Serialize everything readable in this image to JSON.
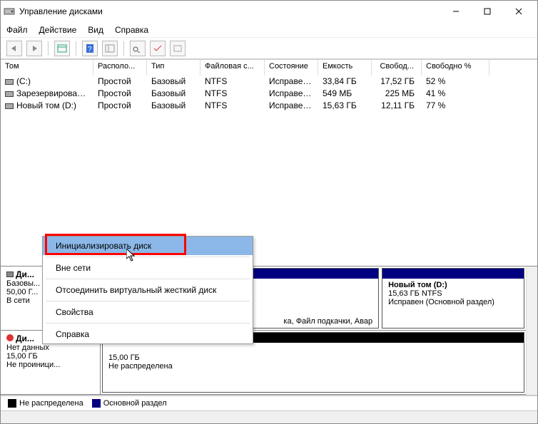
{
  "window": {
    "title": "Управление дисками"
  },
  "menu": {
    "file": "Файл",
    "action": "Действие",
    "view": "Вид",
    "help": "Справка"
  },
  "columns": {
    "vol": "Том",
    "layout": "Располо...",
    "type": "Тип",
    "fs": "Файловая с...",
    "status": "Состояние",
    "cap": "Емкость",
    "free": "Свобод...",
    "freep": "Свободно %"
  },
  "rows": [
    {
      "vol": "(C:)",
      "layout": "Простой",
      "type": "Базовый",
      "fs": "NTFS",
      "status": "Исправен...",
      "cap": "33,84 ГБ",
      "free": "17,52 ГБ",
      "freep": "52 %"
    },
    {
      "vol": "Зарезервировано...",
      "layout": "Простой",
      "type": "Базовый",
      "fs": "NTFS",
      "status": "Исправен...",
      "cap": "549 МБ",
      "free": "225 МБ",
      "freep": "41 %"
    },
    {
      "vol": "Новый том (D:)",
      "layout": "Простой",
      "type": "Базовый",
      "fs": "NTFS",
      "status": "Исправен...",
      "cap": "15,63 ГБ",
      "free": "12,11 ГБ",
      "freep": "77 %"
    }
  ],
  "disk0": {
    "name": "Ди...",
    "type": "Базовы...",
    "size": "50,00 Г...",
    "status": "В сети",
    "p1": {
      "tail": "ка, Файл подкачки, Авар"
    },
    "p2": {
      "name": "Новый том  (D:)",
      "sizefs": "15,63 ГБ NTFS",
      "status": "Исправен (Основной раздел)"
    }
  },
  "disk1": {
    "name": "Ди...",
    "type": "Нет данных",
    "size": "15,00 ГБ",
    "status": "Не проиници...",
    "p1": {
      "size": "15,00 ГБ",
      "status": "Не распределена"
    }
  },
  "legend": {
    "un": "Не распределена",
    "pri": "Основной раздел"
  },
  "context": {
    "init": "Инициализировать диск",
    "offline": "Вне сети",
    "detach": "Отсоединить виртуальный жесткий диск",
    "props": "Свойства",
    "help": "Справка"
  }
}
